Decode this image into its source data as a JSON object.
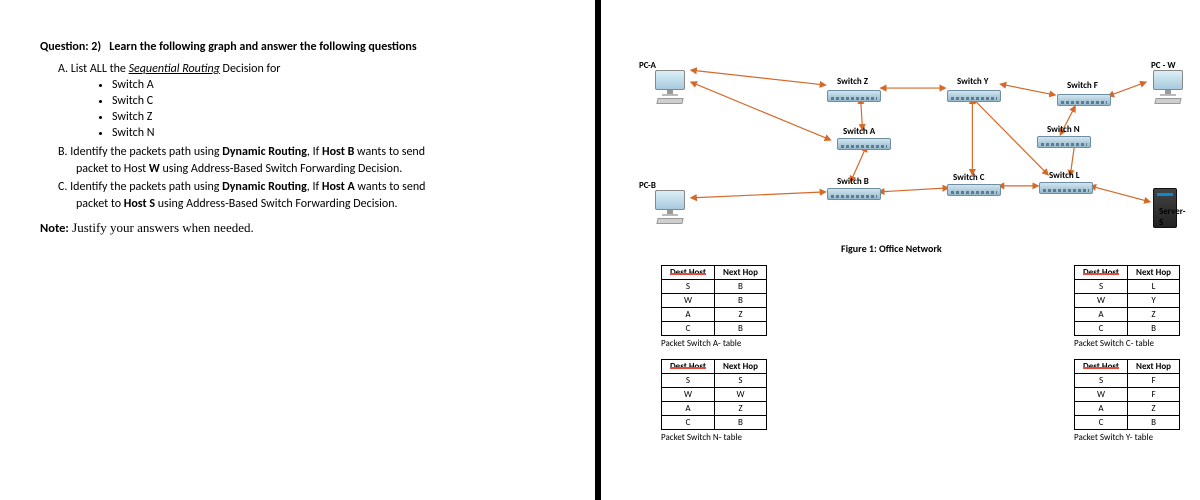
{
  "left": {
    "title_pre": "Question: 2)",
    "title_rest": "Learn the following graph and answer the following questions",
    "a_pre": "A.  List ALL the ",
    "a_underline": "Sequential Routing",
    "a_post": " Decision for",
    "bullets": [
      "Switch  A",
      "Switch C",
      "Switch Z",
      "Switch N"
    ],
    "b_line1_pre": "B.  Identify the packets path using ",
    "b_bold1": "Dynamic Routing",
    "b_mid": ", If ",
    "b_bold2": "Host B",
    "b_after": " wants to send",
    "b_line2_pre": "packet to Host ",
    "b_line2_bold": "W",
    "b_line2_post": " using Address-Based Switch Forwarding Decision.",
    "c_line1_pre": "C.  Identify the packets path using ",
    "c_bold1": "Dynamic Routing",
    "c_mid": ", If ",
    "c_bold2": "Host A",
    "c_after": " wants to send",
    "c_line2_pre": "packet to ",
    "c_line2_bold": "Host S",
    "c_line2_post": " using Address-Based Switch Forwarding Decision.",
    "note_bold": "Note:",
    "note_rest": " Justify your answers when needed."
  },
  "right": {
    "labels": {
      "pca": "PC-A",
      "pcw": "PC - W",
      "pcb": "PC-B",
      "server": "Server- S",
      "sz": "Switch Z",
      "sy": "Switch Y",
      "sf": "Switch F",
      "sa": "Switch A",
      "sn": "Switch N",
      "sb": "Switch B",
      "sc": "Switch C",
      "sl": "Switch L",
      "figcap": "Figure 1: Office Network"
    },
    "tables": {
      "headers": [
        "Dest Host",
        "Next Hop"
      ],
      "a": {
        "rows": [
          [
            "S",
            "B"
          ],
          [
            "W",
            "B"
          ],
          [
            "A",
            "Z"
          ],
          [
            "C",
            "B"
          ]
        ],
        "cap": "Packet Switch A- table"
      },
      "c": {
        "rows": [
          [
            "S",
            "L"
          ],
          [
            "W",
            "Y"
          ],
          [
            "A",
            "Z"
          ],
          [
            "C",
            "B"
          ]
        ],
        "cap": "Packet Switch C- table"
      },
      "n": {
        "rows": [
          [
            "S",
            "S"
          ],
          [
            "W",
            "W"
          ],
          [
            "A",
            "Z"
          ],
          [
            "C",
            "B"
          ]
        ],
        "cap": "Packet Switch N- table"
      },
      "y": {
        "rows": [
          [
            "S",
            "F"
          ],
          [
            "W",
            "F"
          ],
          [
            "A",
            "Z"
          ],
          [
            "C",
            "B"
          ]
        ],
        "cap": "Packet Switch Y- table"
      }
    }
  }
}
